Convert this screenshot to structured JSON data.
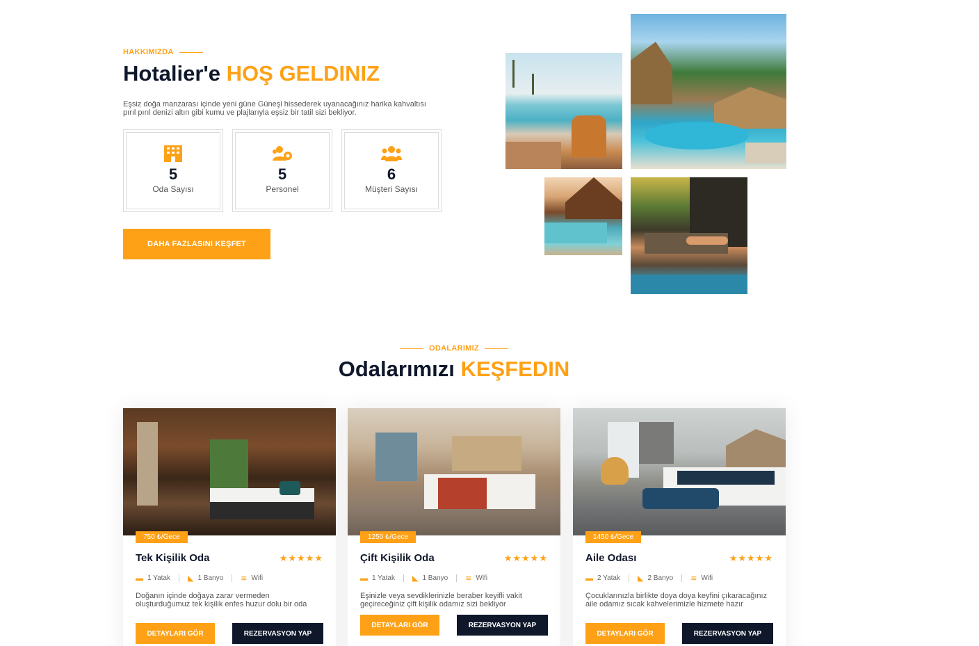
{
  "about": {
    "eyebrow": "HAKKIMIZDA",
    "title_main": "Hotalier'e ",
    "title_accent": "HOŞ GELDINIZ",
    "description": "Eşsiz doğa manzarası içinde yeni güne Güneşi hissederek uyanacağınız harika kahvaltısı pırıl pırıl denizi altın gibi kumu ve plajlarıyla eşsiz bir tatil sizi bekliyor.",
    "stats": [
      {
        "icon": "hotel-icon",
        "value": "5",
        "label": "Oda Sayısı"
      },
      {
        "icon": "users-cog-icon",
        "value": "5",
        "label": "Personel"
      },
      {
        "icon": "users-icon",
        "value": "6",
        "label": "Müşteri Sayısı"
      }
    ],
    "explore_button": "DAHA FAZLASINI KEŞFET"
  },
  "rooms_section": {
    "eyebrow": "ODALARIMIZ",
    "title_main": "Odalarımızı ",
    "title_accent": "KEŞFEDIN"
  },
  "rooms": [
    {
      "price": "750 ₺/Gece",
      "name": "Tek Kişilik Oda",
      "stars": "★★★★★",
      "beds": "1 Yatak",
      "baths": "1 Banyo",
      "wifi": "Wifi",
      "description": "Doğanın içinde doğaya zarar vermeden oluşturduğumuz tek kişilik enfes huzur dolu bir oda",
      "details_button": "DETAYLARI GÖR",
      "reserve_button": "REZERVASYON YAP"
    },
    {
      "price": "1250 ₺/Gece",
      "name": "Çift Kişilik Oda",
      "stars": "★★★★★",
      "beds": "1 Yatak",
      "baths": "1 Banyo",
      "wifi": "Wifi",
      "description": "Eşinizle veya sevdiklerinizle beraber keyifli vakit geçireceğiniz çift kişilik odamız sizi bekliyor",
      "details_button": "DETAYLARI GÖR",
      "reserve_button": "REZERVASYON YAP"
    },
    {
      "price": "1450 ₺/Gece",
      "name": "Aile Odası",
      "stars": "★★★★★",
      "beds": "2 Yatak",
      "baths": "2 Banyo",
      "wifi": "Wifi",
      "description": "Çocuklarınızla birlikte doya doya keyfini çıkaracağınız aile odamız sıcak kahvelerimizle hizmete hazır",
      "details_button": "DETAYLARI GÖR",
      "reserve_button": "REZERVASYON YAP"
    }
  ],
  "colors": {
    "accent": "#fea116",
    "dark": "#0f172b"
  }
}
